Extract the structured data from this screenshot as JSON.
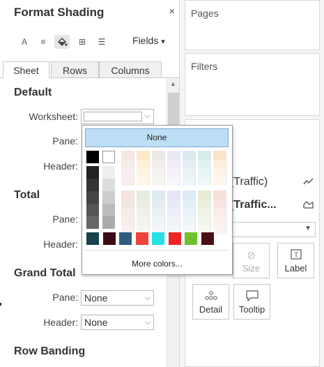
{
  "format_panel": {
    "title": "Format Shading",
    "close_glyph": "×",
    "toolbar": {
      "font_glyph": "A",
      "alignment_glyph": "≡",
      "shading_glyph": "◈",
      "borders_glyph": "⊞",
      "lines_glyph": "☰",
      "fields_label": "Fields",
      "fields_chevron": "▾"
    },
    "tabs": [
      "Sheet",
      "Rows",
      "Columns"
    ],
    "sections": {
      "default": {
        "heading": "Default",
        "worksheet_label": "Worksheet:",
        "pane_label": "Pane:",
        "header_label": "Header:"
      },
      "total": {
        "heading": "Total",
        "pane_label": "Pane:",
        "header_label": "Header:"
      },
      "grand_total": {
        "heading": "Grand Total",
        "pane_label": "Pane:",
        "pane_value": "None",
        "header_label": "Header:",
        "header_value": "None"
      },
      "row_banding": {
        "heading": "Row Banding"
      }
    }
  },
  "color_picker": {
    "none_label": "None",
    "more_colors_label": "More colors...",
    "bottom_row": [
      "#17414f",
      "#3c0a14",
      "#2f5d7e",
      "#f0433a",
      "#27e0e6",
      "#ee2424",
      "#70c02d",
      "#4b0d16"
    ]
  },
  "right_panel": {
    "pages_title": "Pages",
    "filters_title": "Filters",
    "field1": "(Traffic)",
    "field2": "(Traffic...",
    "marks": {
      "size_label": "Size",
      "label_label": "Label",
      "detail_label": "Detail",
      "tooltip_label": "Tooltip"
    }
  }
}
